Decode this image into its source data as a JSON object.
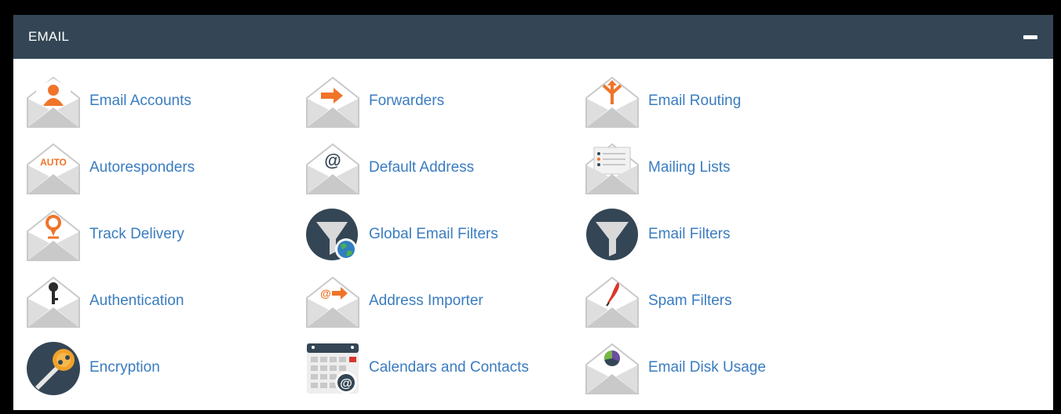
{
  "panel": {
    "title": "EMAIL"
  },
  "colors": {
    "header_bg": "#344655",
    "link": "#3a7cc0",
    "accent_orange": "#f0742a",
    "envelope_gray": "#c9c9c9"
  },
  "items": [
    {
      "label": "Email Accounts",
      "icon": "email-accounts-icon"
    },
    {
      "label": "Forwarders",
      "icon": "forwarders-icon"
    },
    {
      "label": "Email Routing",
      "icon": "email-routing-icon"
    },
    {
      "label": "Autoresponders",
      "icon": "autoresponders-icon",
      "icon_text": "AUTO"
    },
    {
      "label": "Default Address",
      "icon": "default-address-icon",
      "icon_text": "@"
    },
    {
      "label": "Mailing Lists",
      "icon": "mailing-lists-icon"
    },
    {
      "label": "Track Delivery",
      "icon": "track-delivery-icon"
    },
    {
      "label": "Global Email Filters",
      "icon": "global-email-filters-icon"
    },
    {
      "label": "Email Filters",
      "icon": "email-filters-icon"
    },
    {
      "label": "Authentication",
      "icon": "authentication-icon"
    },
    {
      "label": "Address Importer",
      "icon": "address-importer-icon",
      "icon_text": "@"
    },
    {
      "label": "Spam Filters",
      "icon": "spam-filters-icon"
    },
    {
      "label": "Encryption",
      "icon": "encryption-icon"
    },
    {
      "label": "Calendars and Contacts",
      "icon": "calendars-and-contacts-icon",
      "icon_text": "@"
    },
    {
      "label": "Email Disk Usage",
      "icon": "email-disk-usage-icon"
    }
  ]
}
